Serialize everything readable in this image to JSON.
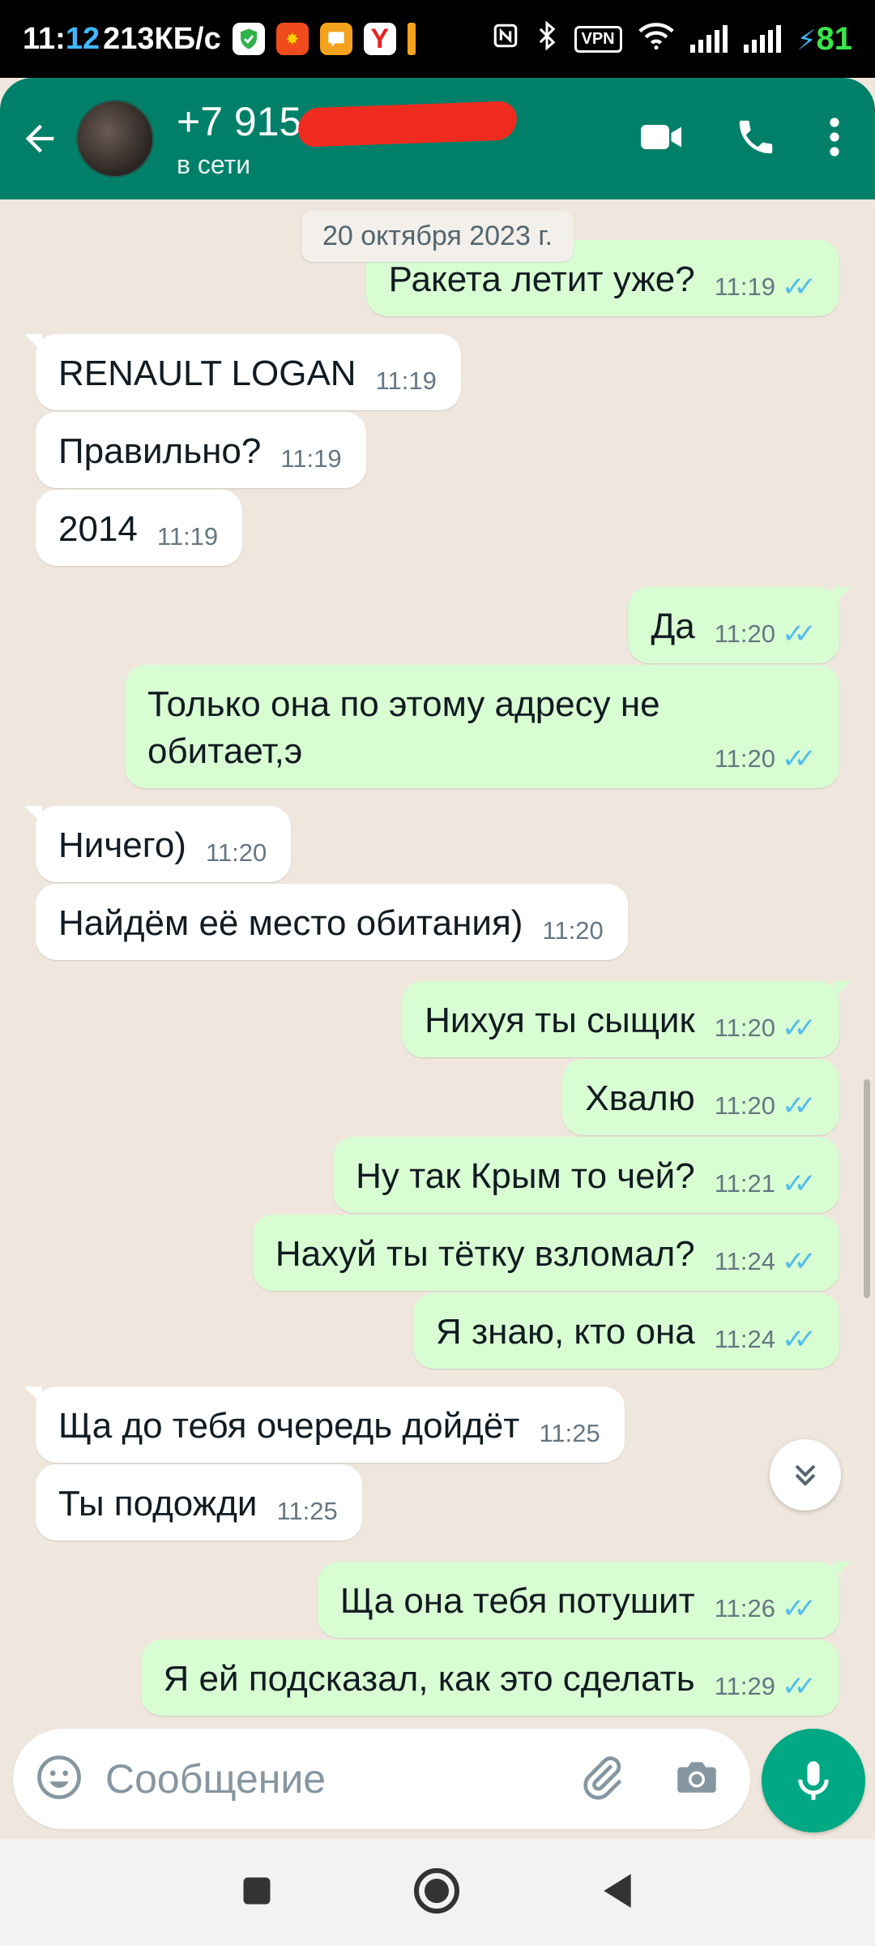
{
  "status_bar": {
    "time_a": "11:",
    "time_b": "12",
    "net_speed": "213КБ/с",
    "vpn": "VPN",
    "battery": "81"
  },
  "header": {
    "contact_name": "+7 915",
    "contact_status": "в сети"
  },
  "chat": {
    "date_chip": "20 октября 2023 г.",
    "messages": [
      {
        "dir": "out",
        "text": "Ракета летит уже?",
        "time": "11:19",
        "read": true
      },
      {
        "dir": "in",
        "text": "RENAULT LOGAN",
        "time": "11:19"
      },
      {
        "dir": "in",
        "text": "Правильно?",
        "time": "11:19"
      },
      {
        "dir": "in",
        "text": "2014",
        "time": "11:19"
      },
      {
        "dir": "out",
        "text": "Да",
        "time": "11:20",
        "read": true
      },
      {
        "dir": "out",
        "text": "Только она по этому адресу не обитает,э",
        "time": "11:20",
        "read": true
      },
      {
        "dir": "in",
        "text": "Ничего)",
        "time": "11:20"
      },
      {
        "dir": "in",
        "text": "Найдём её место обитания)",
        "time": "11:20"
      },
      {
        "dir": "out",
        "text": "Нихуя ты сыщик",
        "time": "11:20",
        "read": true
      },
      {
        "dir": "out",
        "text": "Хвалю",
        "time": "11:20",
        "read": true
      },
      {
        "dir": "out",
        "text": "Ну так Крым то чей?",
        "time": "11:21",
        "read": true
      },
      {
        "dir": "out",
        "text": "Нахуй ты тётку взломал?",
        "time": "11:24",
        "read": true
      },
      {
        "dir": "out",
        "text": "Я знаю, кто она",
        "time": "11:24",
        "read": true
      },
      {
        "dir": "in",
        "text": "Ща до тебя очередь дойдёт",
        "time": "11:25"
      },
      {
        "dir": "in",
        "text": "Ты подожди",
        "time": "11:25"
      },
      {
        "dir": "out",
        "text": "Ща она тебя потушит",
        "time": "11:26",
        "read": true
      },
      {
        "dir": "out",
        "text": "Я ей подсказал, как это сделать",
        "time": "11:29",
        "read": true
      }
    ]
  },
  "input": {
    "placeholder": "Сообщение"
  },
  "colors": {
    "header_green": "#008069",
    "outgoing_bubble": "#d9fdd3",
    "incoming_bubble": "#ffffff",
    "read_ticks": "#53bdeb",
    "mic_button": "#00a884",
    "chat_background": "#efe7dd"
  },
  "icons": [
    "back-arrow-icon",
    "video-call-icon",
    "phone-icon",
    "more-vert-icon",
    "emoji-icon",
    "attach-icon",
    "camera-icon",
    "mic-icon",
    "scroll-down-icon",
    "nav-recents-icon",
    "nav-home-icon",
    "nav-back-icon"
  ]
}
